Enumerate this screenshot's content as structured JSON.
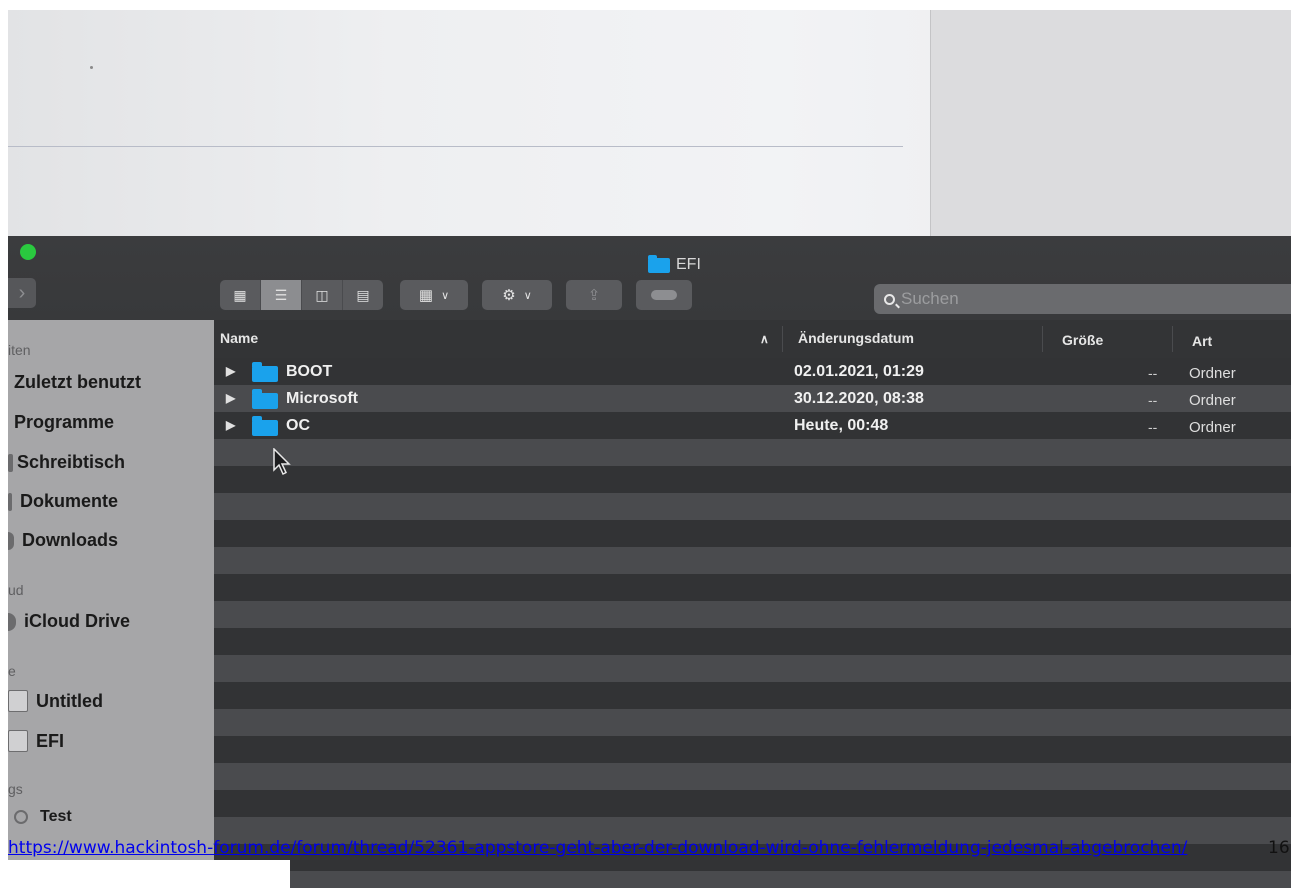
{
  "window": {
    "title": "EFI"
  },
  "toolbar": {
    "view_icons": [
      "icon-view-icon",
      "list-view-icon",
      "column-view-icon",
      "gallery-view-icon"
    ],
    "search_placeholder": "Suchen"
  },
  "sidebar": {
    "section_favorites": "iten",
    "favorites": [
      "Zuletzt benutzt",
      "Programme",
      "Schreibtisch",
      "Dokumente",
      "Downloads"
    ],
    "section_icloud": "ud",
    "icloud": [
      "iCloud Drive"
    ],
    "section_locations": "e",
    "locations": [
      "Untitled",
      "EFI"
    ],
    "section_tags": "gs",
    "tags": [
      "Test"
    ]
  },
  "columns": {
    "name": "Name",
    "date": "Änderungsdatum",
    "size": "Größe",
    "kind": "Art"
  },
  "files": [
    {
      "name": "BOOT",
      "date": "02.01.2021, 01:29",
      "size": "--",
      "kind": "Ordner"
    },
    {
      "name": "Microsoft",
      "date": "30.12.2020, 08:38",
      "size": "--",
      "kind": "Ordner"
    },
    {
      "name": "OC",
      "date": "Heute, 00:48",
      "size": "--",
      "kind": "Ordner"
    }
  ],
  "footer": {
    "link": "https://www.hackintosh-forum.de/forum/thread/52361-appstore-geht-aber-der-download-wird-ohne-fehlermeldung-jedesmal-abgebrochen/",
    "page_number": "16"
  },
  "colors": {
    "folder": "#1aa2ec",
    "green_button": "#2ac93f",
    "sidebar": "#a6a6a8"
  }
}
